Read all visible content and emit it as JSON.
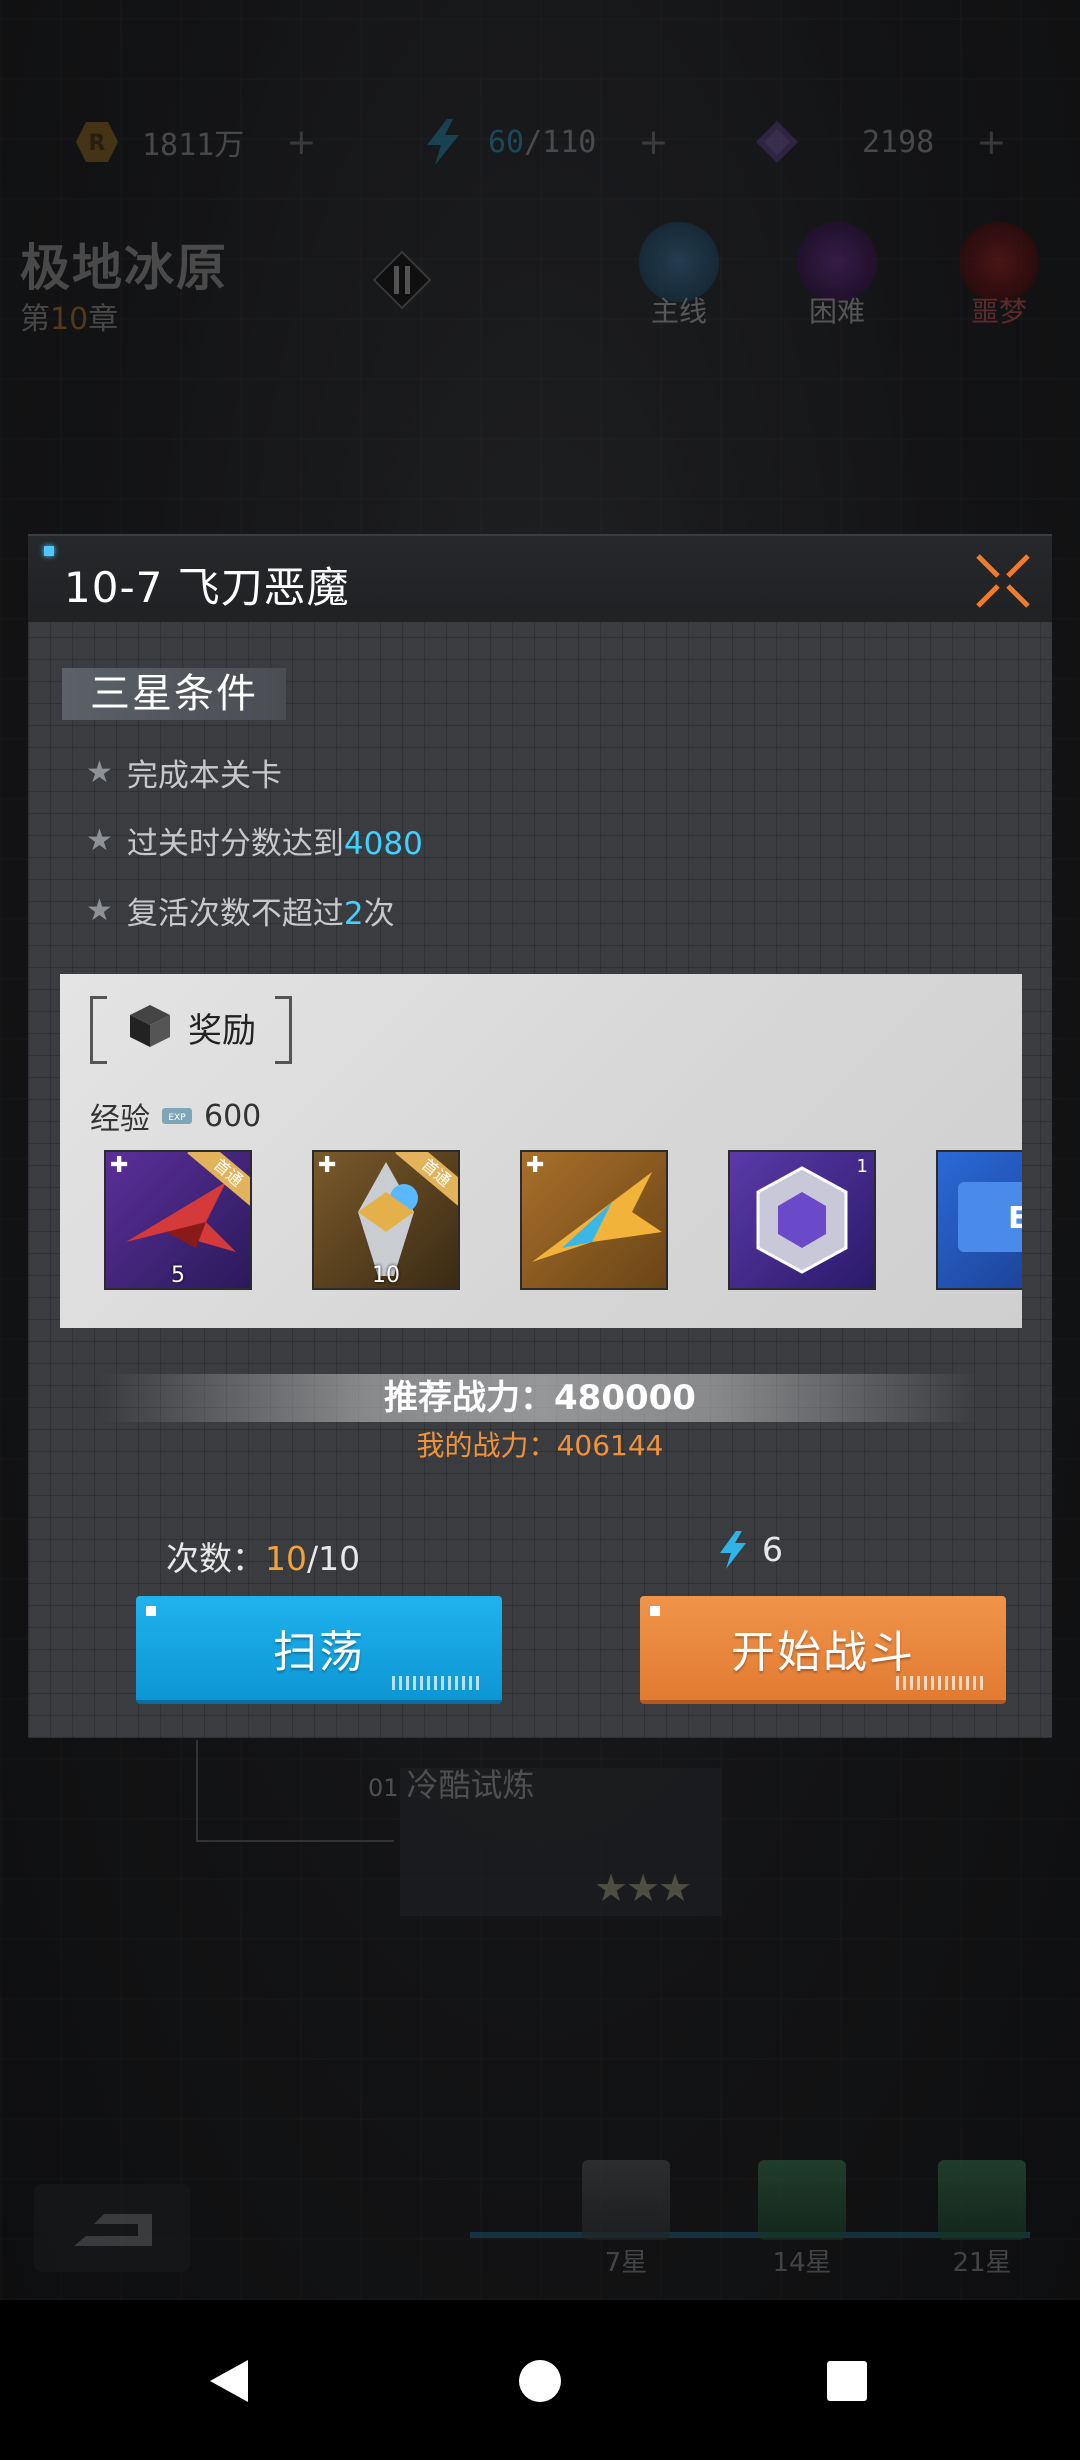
{
  "resources": [
    {
      "icon": "gold-coin-icon",
      "value": "1811万"
    },
    {
      "icon": "energy-icon",
      "value_current": "60",
      "value_max": "/110"
    },
    {
      "icon": "crystal-icon",
      "value": "2198"
    }
  ],
  "chapter": {
    "title": "极地冰原",
    "prefix": "第",
    "number": "10",
    "suffix": "章"
  },
  "modes": [
    "主线",
    "困难",
    "噩梦"
  ],
  "dialog": {
    "title": "10-7 飞刀恶魔",
    "conditions_header": "三星条件",
    "conditions": [
      {
        "text": "完成本关卡",
        "highlight": "",
        "after": ""
      },
      {
        "text": "过关时分数达到",
        "highlight": "4080",
        "after": ""
      },
      {
        "text": "复活次数不超过",
        "highlight": "2",
        "after": "次"
      }
    ],
    "reward": {
      "title": "奖励",
      "exp_label": "经验",
      "exp_value": "600",
      "items": [
        {
          "name": "red-fighter-fragment",
          "count": "5",
          "tag": "首通"
        },
        {
          "name": "gold-fighter-fragment",
          "count": "10",
          "tag": "首通"
        },
        {
          "name": "yellow-fighter",
          "count": "",
          "tag": ""
        },
        {
          "name": "purple-chip",
          "count": "",
          "tag": "",
          "corner": "1"
        },
        {
          "name": "blue-exp-card",
          "count": "",
          "tag": ""
        }
      ]
    },
    "recommended_power_label": "推荐战力：",
    "recommended_power": "480000",
    "my_power_label": "我的战力：",
    "my_power": "406144",
    "attempts_label": "次数：",
    "attempts_current": "10",
    "attempts_max": "/10",
    "energy_cost": "6",
    "sweep_label": "扫荡",
    "battle_label": "开始战斗"
  },
  "background_stage": {
    "index": "01",
    "name": "冷酷试炼"
  },
  "chests": [
    "7星",
    "14星",
    "21星"
  ],
  "colors": {
    "accent_blue": "#35c7ff",
    "accent_orange": "#f2a23a",
    "sweep_button": "#14a5e1",
    "battle_button": "#e9873d"
  }
}
